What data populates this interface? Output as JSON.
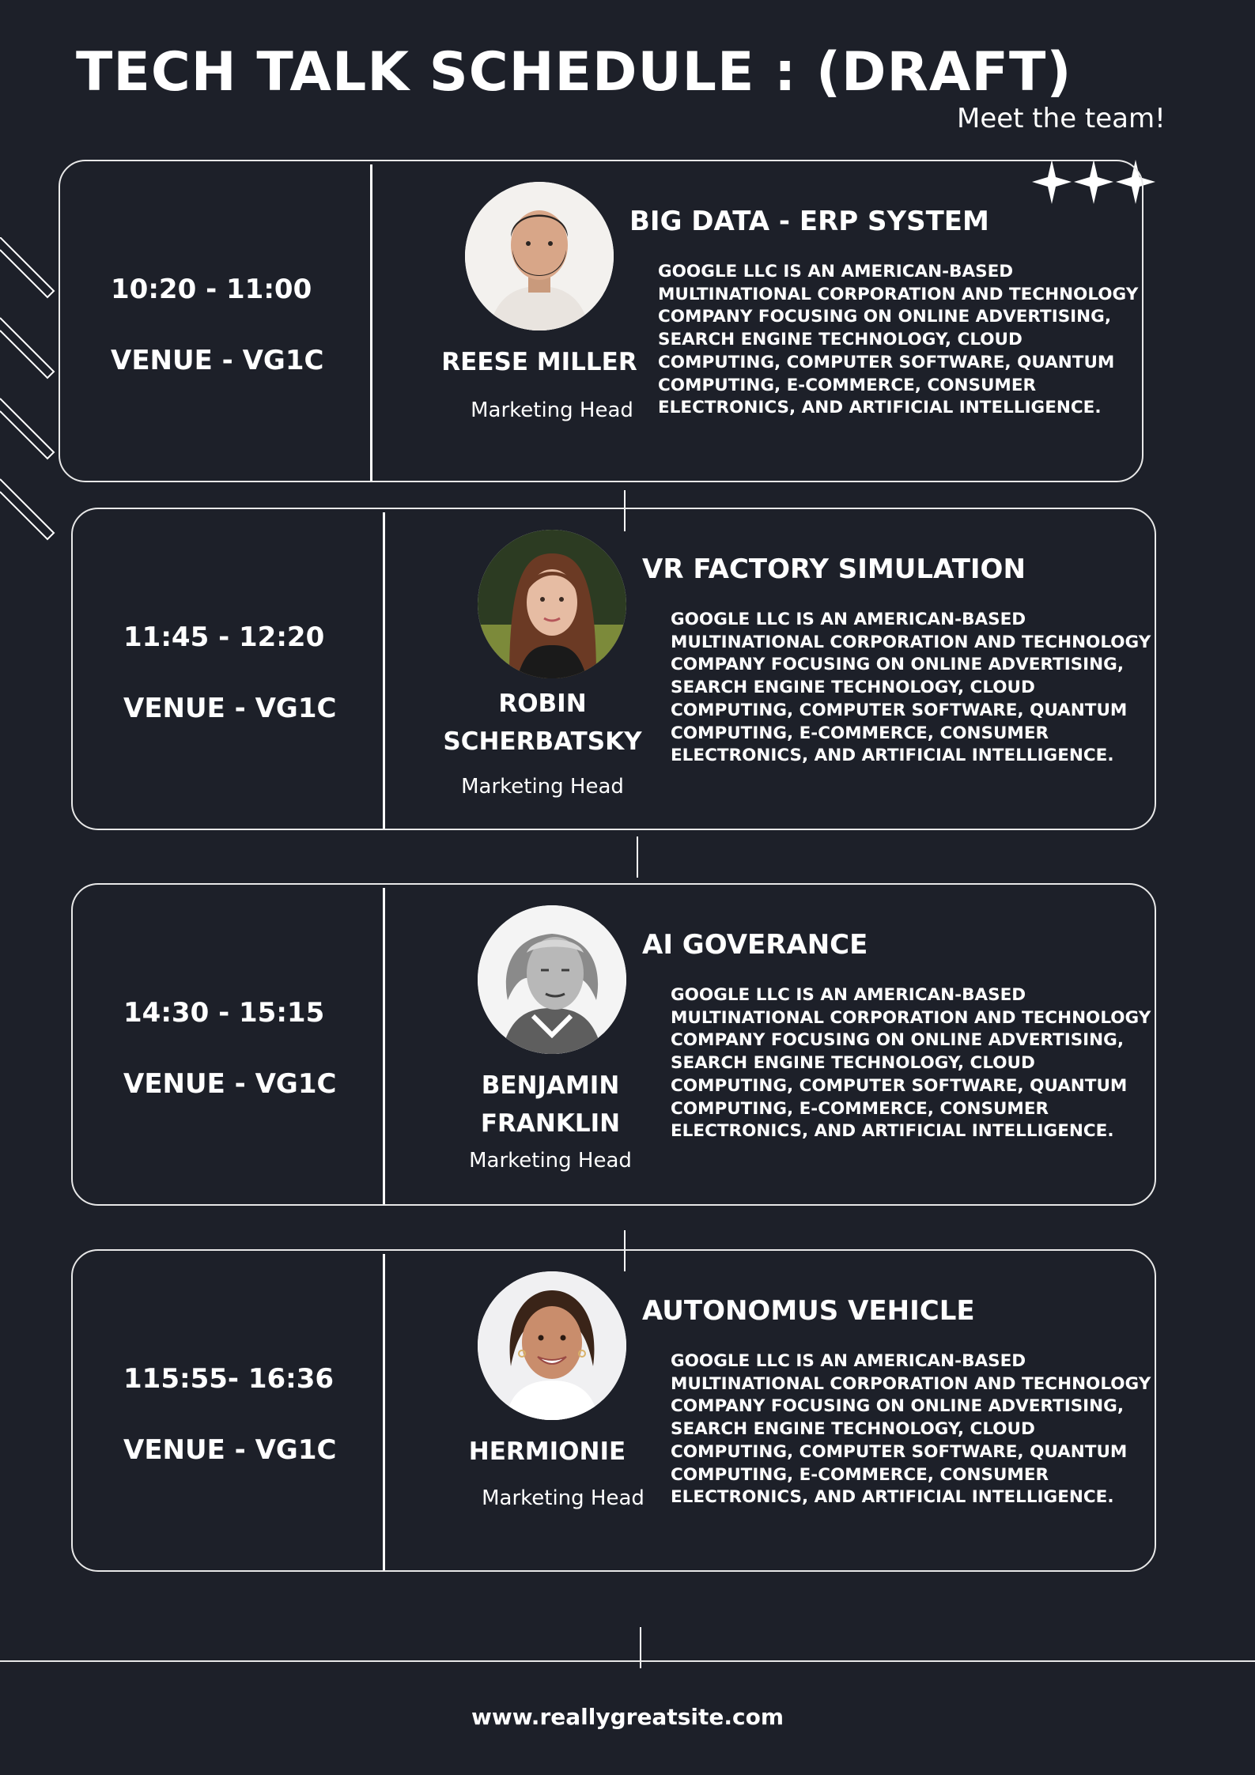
{
  "header": {
    "title": "TECH TALK SCHEDULE : (DRAFT)",
    "tagline": "Meet the team!"
  },
  "sessions": [
    {
      "time": "10:20 - 11:00",
      "venue": "VENUE - VG1C",
      "speaker": "REESE MILLER",
      "role": "Marketing Head",
      "talk_title": "BIG DATA - ERP SYSTEM",
      "description": "GOOGLE LLC IS AN AMERICAN-BASED MULTINATIONAL CORPORATION AND TECHNOLOGY COMPANY FOCUSING ON ONLINE ADVERTISING, SEARCH ENGINE TECHNOLOGY, CLOUD COMPUTING, COMPUTER SOFTWARE, QUANTUM COMPUTING, E-COMMERCE, CONSUMER ELECTRONICS, AND ARTIFICIAL INTELLIGENCE."
    },
    {
      "time": "11:45 - 12:20",
      "venue": "VENUE - VG1C",
      "speaker": "ROBIN SCHERBATSKY",
      "role": "Marketing Head",
      "talk_title": "VR FACTORY SIMULATION",
      "description": "GOOGLE LLC IS AN AMERICAN-BASED MULTINATIONAL CORPORATION AND TECHNOLOGY COMPANY FOCUSING ON ONLINE ADVERTISING, SEARCH ENGINE TECHNOLOGY, CLOUD COMPUTING, COMPUTER SOFTWARE, QUANTUM COMPUTING, E-COMMERCE, CONSUMER ELECTRONICS, AND ARTIFICIAL INTELLIGENCE."
    },
    {
      "time": "14:30 - 15:15",
      "venue": "VENUE - VG1C",
      "speaker": "BENJAMIN FRANKLIN",
      "role": "Marketing Head",
      "talk_title": "AI GOVERANCE",
      "description": "GOOGLE LLC IS AN AMERICAN-BASED MULTINATIONAL CORPORATION AND TECHNOLOGY COMPANY FOCUSING ON ONLINE ADVERTISING, SEARCH ENGINE TECHNOLOGY, CLOUD COMPUTING, COMPUTER SOFTWARE, QUANTUM COMPUTING, E-COMMERCE, CONSUMER ELECTRONICS, AND ARTIFICIAL INTELLIGENCE."
    },
    {
      "time": "115:55- 16:36",
      "venue": "VENUE - VG1C",
      "speaker": "HERMIONIE",
      "role": "Marketing Head",
      "talk_title": "AUTONOMUS VEHICLE",
      "description": "GOOGLE LLC IS AN AMERICAN-BASED MULTINATIONAL CORPORATION AND TECHNOLOGY COMPANY FOCUSING ON ONLINE ADVERTISING, SEARCH ENGINE TECHNOLOGY, CLOUD COMPUTING, COMPUTER SOFTWARE, QUANTUM COMPUTING, E-COMMERCE, CONSUMER ELECTRONICS, AND ARTIFICIAL INTELLIGENCE."
    }
  ],
  "footer": {
    "website": "www.reallygreatsite.com"
  },
  "colors": {
    "background": "#1d2029",
    "text": "#ffffff",
    "border": "#e8e8e8"
  }
}
